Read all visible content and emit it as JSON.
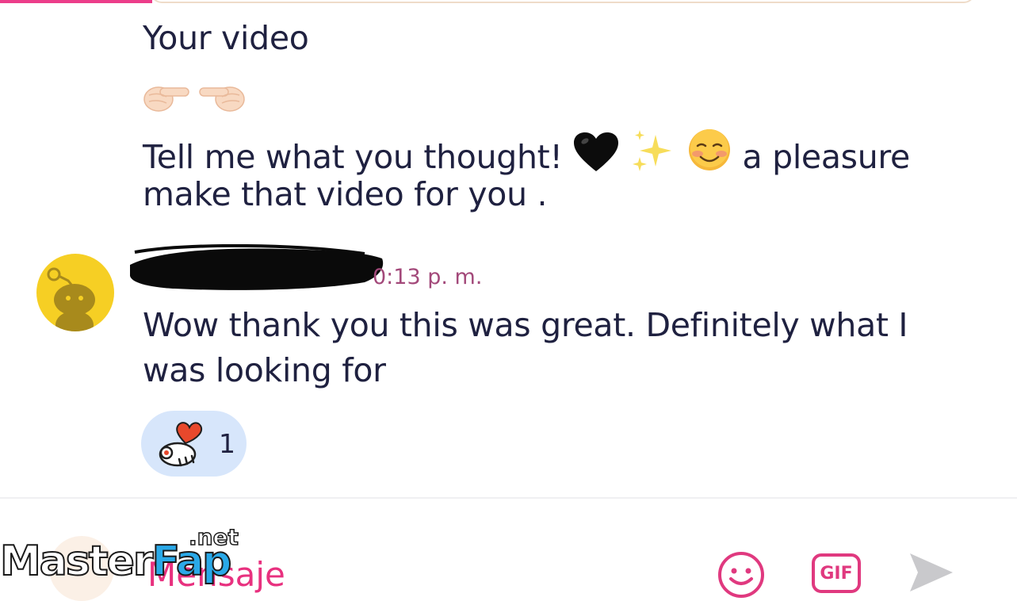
{
  "previous_message": {
    "title": "Your video",
    "emojis": [
      "pointing-right-emoji",
      "pointing-left-emoji"
    ],
    "line1": "Tell me what you thought!",
    "line1_suffix": "a pleasure",
    "line1_emojis": [
      "black-heart-emoji",
      "sparkles-emoji",
      "smiling-blush-emoji"
    ],
    "line2": "make that video for you ."
  },
  "reply": {
    "author": "",
    "timestamp": "0:13 p. m.",
    "line1": "Wow thank you this was great. Definitely what I",
    "line2": "was looking for",
    "reaction": {
      "icon": "snoo-heart-reaction-icon",
      "count": "1"
    }
  },
  "composer": {
    "placeholder": "Mensaje",
    "gif_label": "GIF"
  },
  "watermark": {
    "master": "Master",
    "fap": "Fap",
    "net": ".net"
  },
  "colors": {
    "accent_pink": "#e8317f",
    "timestamp": "#a3497a",
    "avatar_bg": "#f6cf24",
    "reaction_bg": "#d7e6fb",
    "text": "#1f2140"
  }
}
